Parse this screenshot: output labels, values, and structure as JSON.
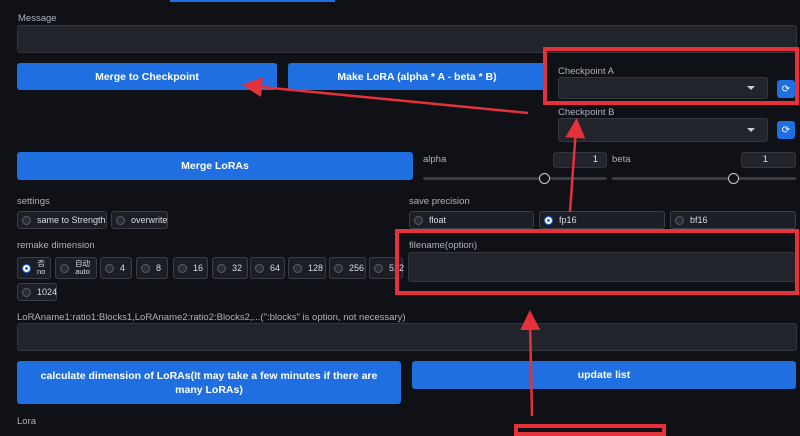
{
  "message": {
    "label": "Message",
    "value": ""
  },
  "buttons": {
    "merge_to_checkpoint": "Merge to Checkpoint",
    "make_lora": "Make LoRA (alpha * A - beta * B)",
    "merge_loras": "Merge LoRAs",
    "calculate_dimension": "calculate dimension of LoRAs(It may take a few minutes if there are many LoRAs)",
    "update_list": "update list"
  },
  "checkpoint_a": {
    "label": "Checkpoint A",
    "value": ""
  },
  "checkpoint_b": {
    "label": "Checkpoint B",
    "value": ""
  },
  "alpha": {
    "label": "alpha",
    "value": "1",
    "level": 0.5
  },
  "beta": {
    "label": "beta",
    "value": "1",
    "level": 0.6
  },
  "settings": {
    "label": "settings",
    "options": [
      "same to Strength",
      "overwrite"
    ]
  },
  "save_precision": {
    "label": "save precision",
    "options": [
      "float",
      "fp16",
      "bf16"
    ],
    "selected": "fp16"
  },
  "remake_dimension": {
    "label": "remake dimension",
    "no_top": "否",
    "no_bottom": "no",
    "auto_top": "自动",
    "auto_bottom": "auto",
    "options": [
      "4",
      "8",
      "16",
      "32",
      "64",
      "128",
      "256",
      "512",
      "1024"
    ]
  },
  "filename": {
    "label": "filename(option)",
    "value": ""
  },
  "lora_spec": {
    "label": "LoRAname1:ratio1:Blocks1,LoRAname2:ratio2:Blocks2,...(\":blocks\" is option, not necessary)",
    "value": ""
  },
  "lora": {
    "label": "Lora"
  },
  "colors": {
    "accent": "#1f6fe0",
    "annotation": "#e5313b",
    "background": "#0f1117"
  }
}
